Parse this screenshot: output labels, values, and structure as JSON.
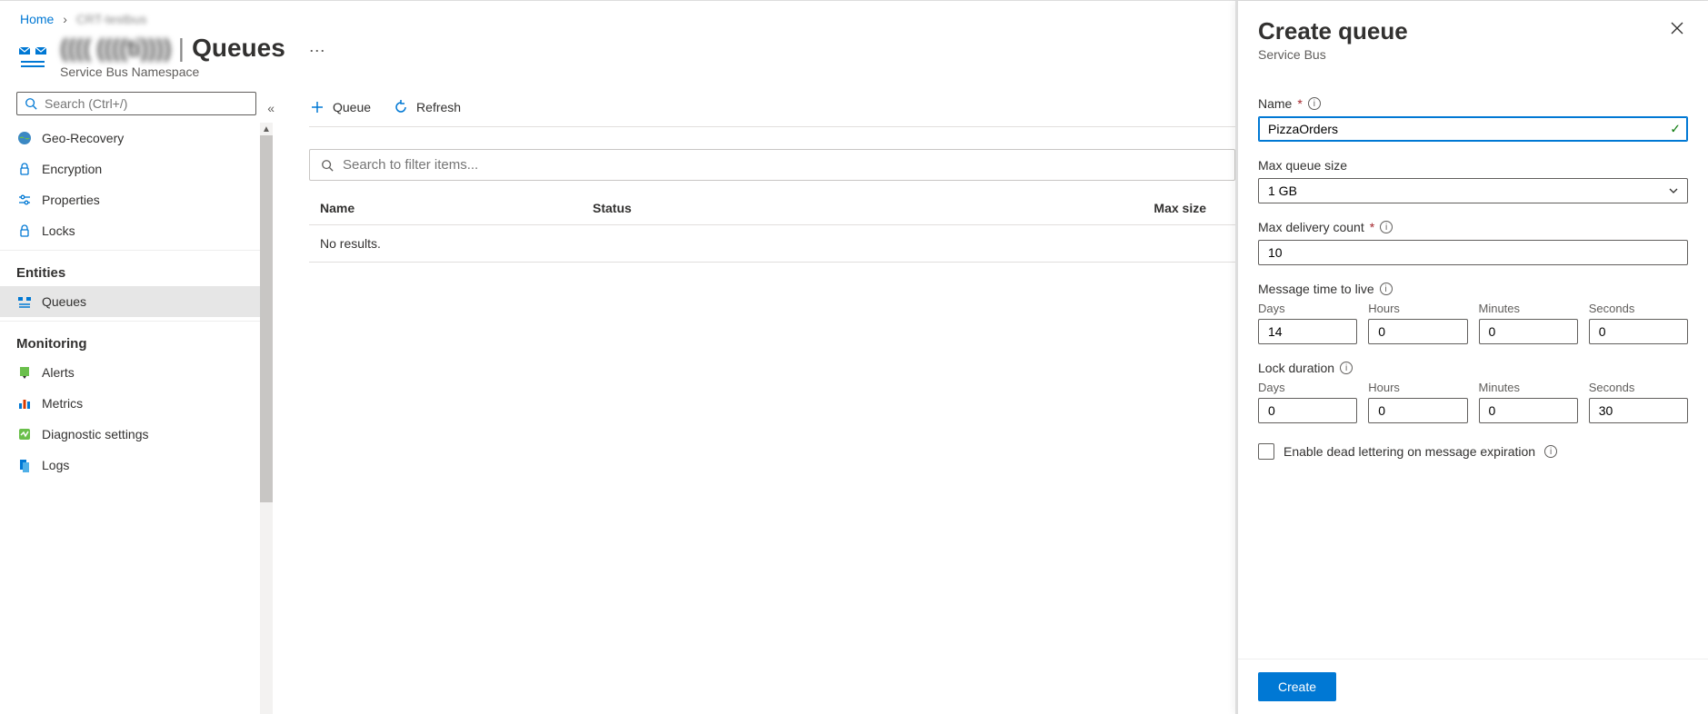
{
  "breadcrumb": {
    "home": "Home",
    "current": "CRT-testbus"
  },
  "resource": {
    "name_masked": "(((( ((((ti))))",
    "section": "Queues",
    "subtype": "Service Bus Namespace"
  },
  "sidebar": {
    "search_placeholder": "Search (Ctrl+/)",
    "items": [
      {
        "label": "Geo-Recovery",
        "icon": "globe-icon"
      },
      {
        "label": "Encryption",
        "icon": "lock-icon"
      },
      {
        "label": "Properties",
        "icon": "settings-icon"
      },
      {
        "label": "Locks",
        "icon": "lock-icon"
      }
    ],
    "group_entities": "Entities",
    "entities": [
      {
        "label": "Queues",
        "icon": "queue-icon",
        "active": true
      }
    ],
    "group_monitoring": "Monitoring",
    "monitoring": [
      {
        "label": "Alerts",
        "icon": "alert-icon"
      },
      {
        "label": "Metrics",
        "icon": "metrics-icon"
      },
      {
        "label": "Diagnostic settings",
        "icon": "diag-icon"
      },
      {
        "label": "Logs",
        "icon": "logs-icon"
      }
    ]
  },
  "toolbar": {
    "add_label": "Queue",
    "refresh_label": "Refresh"
  },
  "filter": {
    "placeholder": "Search to filter items..."
  },
  "table": {
    "col_name": "Name",
    "col_status": "Status",
    "col_max": "Max size",
    "empty": "No results."
  },
  "panel": {
    "title": "Create queue",
    "subtitle": "Service Bus",
    "name_label": "Name",
    "name_value": "PizzaOrders",
    "max_size_label": "Max queue size",
    "max_size_value": "1 GB",
    "delivery_label": "Max delivery count",
    "delivery_value": "10",
    "ttl_label": "Message time to live",
    "ttl": {
      "days_label": "Days",
      "days": "14",
      "hours_label": "Hours",
      "hours": "0",
      "minutes_label": "Minutes",
      "minutes": "0",
      "seconds_label": "Seconds",
      "seconds": "0"
    },
    "lock_label": "Lock duration",
    "lock": {
      "days_label": "Days",
      "days": "0",
      "hours_label": "Hours",
      "hours": "0",
      "minutes_label": "Minutes",
      "minutes": "0",
      "seconds_label": "Seconds",
      "seconds": "30"
    },
    "dead_letter_label": "Enable dead lettering on message expiration",
    "create_label": "Create"
  }
}
